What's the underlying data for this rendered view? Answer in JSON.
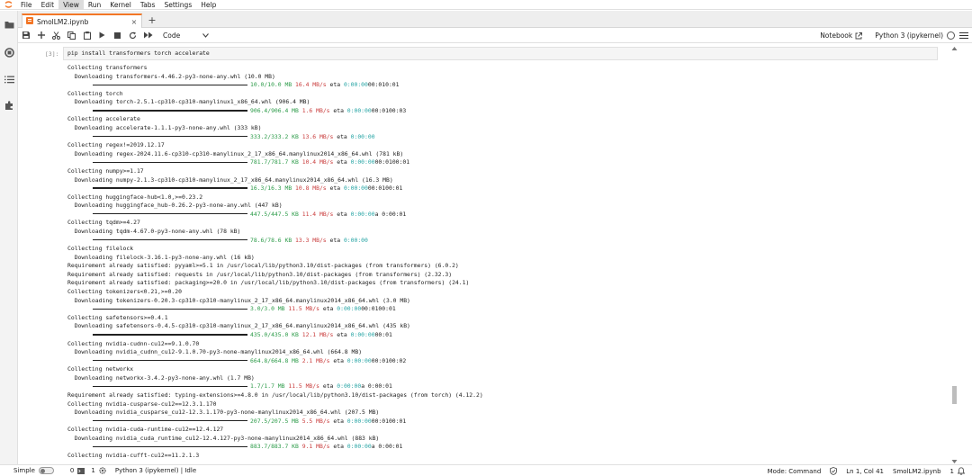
{
  "menubar": {
    "items": [
      "File",
      "Edit",
      "View",
      "Run",
      "Kernel",
      "Tabs",
      "Settings",
      "Help"
    ],
    "active_index": 2
  },
  "left_rail": {
    "icons": [
      "folder-icon",
      "running-icon",
      "table-of-contents-icon",
      "extensions-icon"
    ]
  },
  "tab": {
    "title": "SmolLM2.ipynb",
    "close_glyph": "×",
    "new_tab_glyph": "+"
  },
  "toolbar": {
    "cell_type": "Code",
    "notebook_label": "Notebook",
    "kernel_name": "Python 3 (ipykernel)"
  },
  "cell": {
    "prompt": "[3]:",
    "input": "pip install transformers torch accelerate"
  },
  "output_lines": [
    {
      "type": "text",
      "text": "Collecting transformers"
    },
    {
      "type": "text",
      "text": "  Downloading transformers-4.46.2-py3-none-any.whl (10.0 MB)"
    },
    {
      "type": "progress",
      "size": "10.0/10.0 MB",
      "speed": "16.4 MB/s",
      "eta": "eta",
      "time": "0:00:00",
      "extra": "00:010:01"
    },
    {
      "type": "text",
      "text": "Collecting torch"
    },
    {
      "type": "text",
      "text": "  Downloading torch-2.5.1-cp310-cp310-manylinux1_x86_64.whl (906.4 MB)"
    },
    {
      "type": "progress",
      "size": "906.4/906.4 MB",
      "speed": "1.6 MB/s",
      "eta": "eta",
      "time": "0:00:00",
      "extra": "00:0100:03"
    },
    {
      "type": "text",
      "text": "Collecting accelerate"
    },
    {
      "type": "text",
      "text": "  Downloading accelerate-1.1.1-py3-none-any.whl (333 kB)"
    },
    {
      "type": "progress",
      "size": "333.2/333.2 KB",
      "speed": "13.6 MB/s",
      "eta": "eta",
      "time": "0:00:00",
      "extra": ""
    },
    {
      "type": "text",
      "text": "Collecting regex!=2019.12.17"
    },
    {
      "type": "text",
      "text": "  Downloading regex-2024.11.6-cp310-cp310-manylinux_2_17_x86_64.manylinux2014_x86_64.whl (781 kB)"
    },
    {
      "type": "progress",
      "size": "781.7/781.7 KB",
      "speed": "10.4 MB/s",
      "eta": "eta",
      "time": "0:00:00",
      "extra": "00:0100:01"
    },
    {
      "type": "text",
      "text": "Collecting numpy>=1.17"
    },
    {
      "type": "text",
      "text": "  Downloading numpy-2.1.3-cp310-cp310-manylinux_2_17_x86_64.manylinux2014_x86_64.whl (16.3 MB)"
    },
    {
      "type": "progress",
      "size": "16.3/16.3 MB",
      "speed": "10.8 MB/s",
      "eta": "eta",
      "time": "0:00:00",
      "extra": "00:0100:01"
    },
    {
      "type": "text",
      "text": "Collecting huggingface-hub<1.0,>=0.23.2"
    },
    {
      "type": "text",
      "text": "  Downloading huggingface_hub-0.26.2-py3-none-any.whl (447 kB)"
    },
    {
      "type": "progress",
      "size": "447.5/447.5 KB",
      "speed": "11.4 MB/s",
      "eta": "eta",
      "time": "0:00:00",
      "extra": "a 0:00:01"
    },
    {
      "type": "text",
      "text": "Collecting tqdm>=4.27"
    },
    {
      "type": "text",
      "text": "  Downloading tqdm-4.67.0-py3-none-any.whl (78 kB)"
    },
    {
      "type": "progress",
      "size": "78.6/78.6 KB",
      "speed": "13.3 MB/s",
      "eta": "eta",
      "time": "0:00:00",
      "extra": ""
    },
    {
      "type": "text",
      "text": "Collecting filelock"
    },
    {
      "type": "text",
      "text": "  Downloading filelock-3.16.1-py3-none-any.whl (16 kB)"
    },
    {
      "type": "text",
      "text": "Requirement already satisfied: pyyaml>=5.1 in /usr/local/lib/python3.10/dist-packages (from transformers) (6.0.2)"
    },
    {
      "type": "text",
      "text": "Requirement already satisfied: requests in /usr/local/lib/python3.10/dist-packages (from transformers) (2.32.3)"
    },
    {
      "type": "text",
      "text": "Requirement already satisfied: packaging>=20.0 in /usr/local/lib/python3.10/dist-packages (from transformers) (24.1)"
    },
    {
      "type": "text",
      "text": "Collecting tokenizers<0.21,>=0.20"
    },
    {
      "type": "text",
      "text": "  Downloading tokenizers-0.20.3-cp310-cp310-manylinux_2_17_x86_64.manylinux2014_x86_64.whl (3.0 MB)"
    },
    {
      "type": "progress",
      "size": "3.0/3.0 MB",
      "speed": "11.5 MB/s",
      "eta": "eta",
      "time": "0:00:00",
      "extra": "00:0100:01"
    },
    {
      "type": "text",
      "text": "Collecting safetensors>=0.4.1"
    },
    {
      "type": "text",
      "text": "  Downloading safetensors-0.4.5-cp310-cp310-manylinux_2_17_x86_64.manylinux2014_x86_64.whl (435 kB)"
    },
    {
      "type": "progress",
      "size": "435.0/435.0 KB",
      "speed": "12.1 MB/s",
      "eta": "eta",
      "time": "0:00:00",
      "extra": "00:01"
    },
    {
      "type": "text",
      "text": "Collecting nvidia-cudnn-cu12==9.1.0.70"
    },
    {
      "type": "text",
      "text": "  Downloading nvidia_cudnn_cu12-9.1.0.70-py3-none-manylinux2014_x86_64.whl (664.8 MB)"
    },
    {
      "type": "progress",
      "size": "664.8/664.8 MB",
      "speed": "2.1 MB/s",
      "eta": "eta",
      "time": "0:00:00",
      "extra": "00:0100:02"
    },
    {
      "type": "text",
      "text": "Collecting networkx"
    },
    {
      "type": "text",
      "text": "  Downloading networkx-3.4.2-py3-none-any.whl (1.7 MB)"
    },
    {
      "type": "progress",
      "size": "1.7/1.7 MB",
      "speed": "11.5 MB/s",
      "eta": "eta",
      "time": "0:00:00",
      "extra": "a 0:00:01"
    },
    {
      "type": "text",
      "text": "Requirement already satisfied: typing-extensions>=4.8.0 in /usr/local/lib/python3.10/dist-packages (from torch) (4.12.2)"
    },
    {
      "type": "text",
      "text": "Collecting nvidia-cusparse-cu12==12.3.1.170"
    },
    {
      "type": "text",
      "text": "  Downloading nvidia_cusparse_cu12-12.3.1.170-py3-none-manylinux2014_x86_64.whl (207.5 MB)"
    },
    {
      "type": "progress",
      "size": "207.5/207.5 MB",
      "speed": "5.5 MB/s",
      "eta": "eta",
      "time": "0:00:00",
      "extra": "00:0100:01"
    },
    {
      "type": "text",
      "text": "Collecting nvidia-cuda-runtime-cu12==12.4.127"
    },
    {
      "type": "text",
      "text": "  Downloading nvidia_cuda_runtime_cu12-12.4.127-py3-none-manylinux2014_x86_64.whl (883 kB)"
    },
    {
      "type": "progress",
      "size": "883.7/883.7 KB",
      "speed": "9.1 MB/s",
      "eta": "eta",
      "time": "0:00:00",
      "extra": "a 0:00:01"
    },
    {
      "type": "text",
      "text": "Collecting nvidia-cufft-cu12==11.2.1.3"
    }
  ],
  "statusbar": {
    "simple_label": "Simple",
    "terminals_count": "0",
    "kernels_count": "1",
    "kernel_status": "Python 3 (ipykernel) | Idle",
    "mode": "Mode: Command",
    "position": "Ln 1, Col 41",
    "filename": "SmolLM2.ipynb",
    "notifications": "1"
  },
  "colors": {
    "accent_orange": "#f37626",
    "progress_green": "#2a9a47",
    "speed_red": "#c93b3b",
    "eta_cyan": "#23a3a3"
  }
}
